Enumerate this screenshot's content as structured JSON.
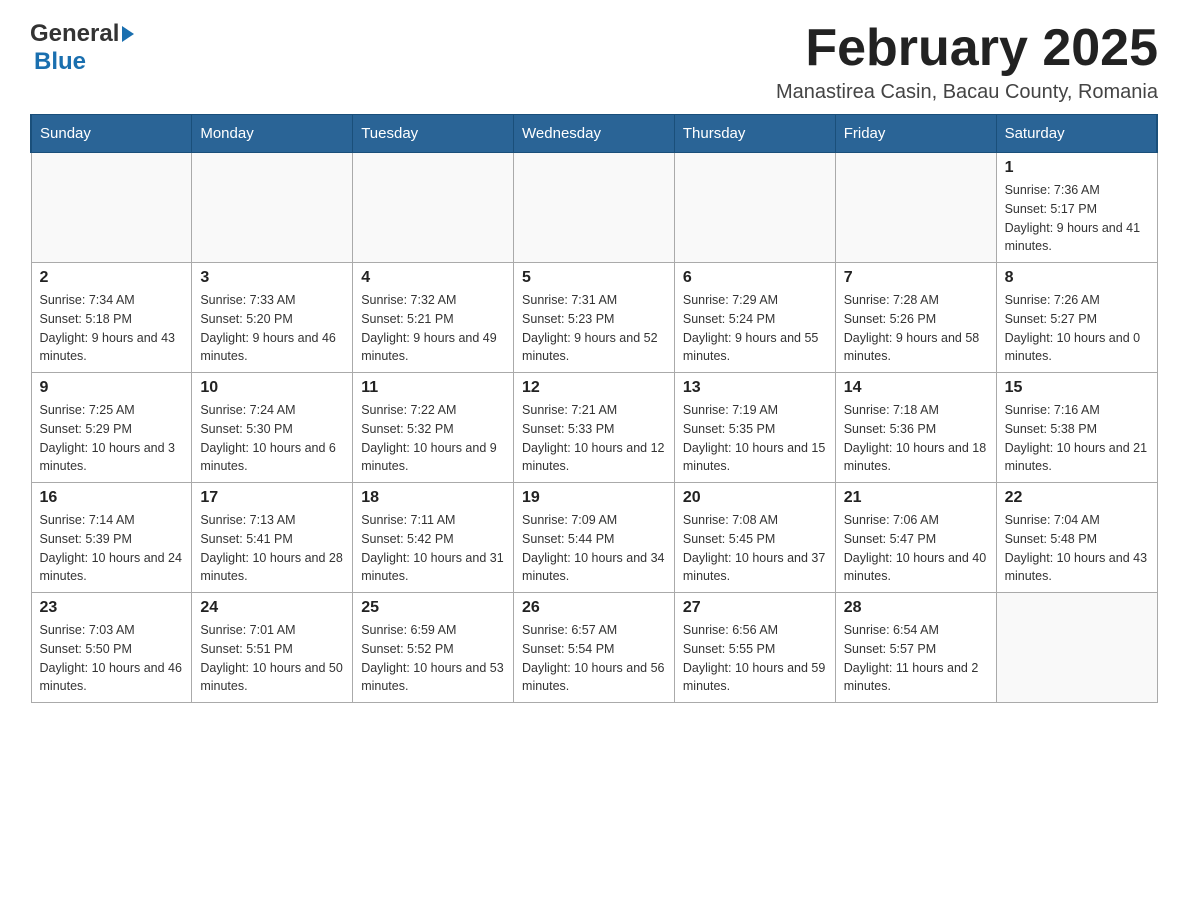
{
  "logo": {
    "general": "General",
    "arrow": "▶",
    "blue": "Blue"
  },
  "title": "February 2025",
  "subtitle": "Manastirea Casin, Bacau County, Romania",
  "days_of_week": [
    "Sunday",
    "Monday",
    "Tuesday",
    "Wednesday",
    "Thursday",
    "Friday",
    "Saturday"
  ],
  "weeks": [
    [
      {
        "day": "",
        "info": ""
      },
      {
        "day": "",
        "info": ""
      },
      {
        "day": "",
        "info": ""
      },
      {
        "day": "",
        "info": ""
      },
      {
        "day": "",
        "info": ""
      },
      {
        "day": "",
        "info": ""
      },
      {
        "day": "1",
        "info": "Sunrise: 7:36 AM\nSunset: 5:17 PM\nDaylight: 9 hours and 41 minutes."
      }
    ],
    [
      {
        "day": "2",
        "info": "Sunrise: 7:34 AM\nSunset: 5:18 PM\nDaylight: 9 hours and 43 minutes."
      },
      {
        "day": "3",
        "info": "Sunrise: 7:33 AM\nSunset: 5:20 PM\nDaylight: 9 hours and 46 minutes."
      },
      {
        "day": "4",
        "info": "Sunrise: 7:32 AM\nSunset: 5:21 PM\nDaylight: 9 hours and 49 minutes."
      },
      {
        "day": "5",
        "info": "Sunrise: 7:31 AM\nSunset: 5:23 PM\nDaylight: 9 hours and 52 minutes."
      },
      {
        "day": "6",
        "info": "Sunrise: 7:29 AM\nSunset: 5:24 PM\nDaylight: 9 hours and 55 minutes."
      },
      {
        "day": "7",
        "info": "Sunrise: 7:28 AM\nSunset: 5:26 PM\nDaylight: 9 hours and 58 minutes."
      },
      {
        "day": "8",
        "info": "Sunrise: 7:26 AM\nSunset: 5:27 PM\nDaylight: 10 hours and 0 minutes."
      }
    ],
    [
      {
        "day": "9",
        "info": "Sunrise: 7:25 AM\nSunset: 5:29 PM\nDaylight: 10 hours and 3 minutes."
      },
      {
        "day": "10",
        "info": "Sunrise: 7:24 AM\nSunset: 5:30 PM\nDaylight: 10 hours and 6 minutes."
      },
      {
        "day": "11",
        "info": "Sunrise: 7:22 AM\nSunset: 5:32 PM\nDaylight: 10 hours and 9 minutes."
      },
      {
        "day": "12",
        "info": "Sunrise: 7:21 AM\nSunset: 5:33 PM\nDaylight: 10 hours and 12 minutes."
      },
      {
        "day": "13",
        "info": "Sunrise: 7:19 AM\nSunset: 5:35 PM\nDaylight: 10 hours and 15 minutes."
      },
      {
        "day": "14",
        "info": "Sunrise: 7:18 AM\nSunset: 5:36 PM\nDaylight: 10 hours and 18 minutes."
      },
      {
        "day": "15",
        "info": "Sunrise: 7:16 AM\nSunset: 5:38 PM\nDaylight: 10 hours and 21 minutes."
      }
    ],
    [
      {
        "day": "16",
        "info": "Sunrise: 7:14 AM\nSunset: 5:39 PM\nDaylight: 10 hours and 24 minutes."
      },
      {
        "day": "17",
        "info": "Sunrise: 7:13 AM\nSunset: 5:41 PM\nDaylight: 10 hours and 28 minutes."
      },
      {
        "day": "18",
        "info": "Sunrise: 7:11 AM\nSunset: 5:42 PM\nDaylight: 10 hours and 31 minutes."
      },
      {
        "day": "19",
        "info": "Sunrise: 7:09 AM\nSunset: 5:44 PM\nDaylight: 10 hours and 34 minutes."
      },
      {
        "day": "20",
        "info": "Sunrise: 7:08 AM\nSunset: 5:45 PM\nDaylight: 10 hours and 37 minutes."
      },
      {
        "day": "21",
        "info": "Sunrise: 7:06 AM\nSunset: 5:47 PM\nDaylight: 10 hours and 40 minutes."
      },
      {
        "day": "22",
        "info": "Sunrise: 7:04 AM\nSunset: 5:48 PM\nDaylight: 10 hours and 43 minutes."
      }
    ],
    [
      {
        "day": "23",
        "info": "Sunrise: 7:03 AM\nSunset: 5:50 PM\nDaylight: 10 hours and 46 minutes."
      },
      {
        "day": "24",
        "info": "Sunrise: 7:01 AM\nSunset: 5:51 PM\nDaylight: 10 hours and 50 minutes."
      },
      {
        "day": "25",
        "info": "Sunrise: 6:59 AM\nSunset: 5:52 PM\nDaylight: 10 hours and 53 minutes."
      },
      {
        "day": "26",
        "info": "Sunrise: 6:57 AM\nSunset: 5:54 PM\nDaylight: 10 hours and 56 minutes."
      },
      {
        "day": "27",
        "info": "Sunrise: 6:56 AM\nSunset: 5:55 PM\nDaylight: 10 hours and 59 minutes."
      },
      {
        "day": "28",
        "info": "Sunrise: 6:54 AM\nSunset: 5:57 PM\nDaylight: 11 hours and 2 minutes."
      },
      {
        "day": "",
        "info": ""
      }
    ]
  ]
}
